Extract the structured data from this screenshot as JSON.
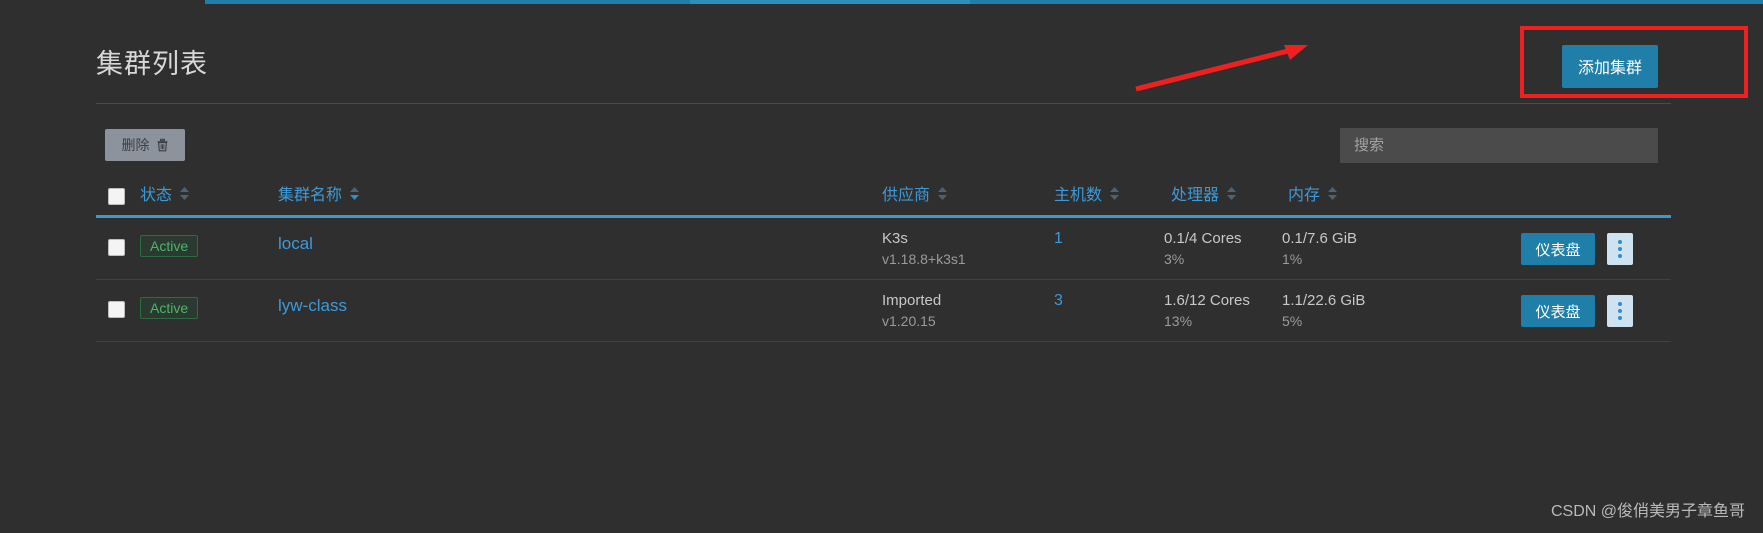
{
  "page": {
    "title": "集群列表",
    "watermark": "CSDN @俊俏美男子章鱼哥"
  },
  "toolbar": {
    "add_cluster_label": "添加集群",
    "delete_label": "删除",
    "search_placeholder": "搜索",
    "search_value": ""
  },
  "colors": {
    "accent": "#1f7fa8",
    "link": "#3d9ad9",
    "header_underline": "#3c99cf",
    "annotation": "#ef2020",
    "badge_text": "#4cb46c",
    "background": "#2f2f2f"
  },
  "table": {
    "columns": [
      {
        "label": "状态",
        "sorted": false
      },
      {
        "label": "集群名称",
        "sorted": true
      },
      {
        "label": "供应商",
        "sorted": false
      },
      {
        "label": "主机数",
        "sorted": false
      },
      {
        "label": "处理器",
        "sorted": false
      },
      {
        "label": "内存",
        "sorted": false
      }
    ],
    "rows": [
      {
        "state": "Active",
        "name": "local",
        "provider": "K3s",
        "version": "v1.18.8+k3s1",
        "hosts": "1",
        "cpu": "0.1/4 Cores",
        "cpu_pct": "3%",
        "memory": "0.1/7.6 GiB",
        "memory_pct": "1%",
        "dashboard_label": "仪表盘"
      },
      {
        "state": "Active",
        "name": "lyw-class",
        "provider": "Imported",
        "version": "v1.20.15",
        "hosts": "3",
        "cpu": "1.6/12 Cores",
        "cpu_pct": "13%",
        "memory": "1.1/22.6 GiB",
        "memory_pct": "5%",
        "dashboard_label": "仪表盘"
      }
    ]
  }
}
